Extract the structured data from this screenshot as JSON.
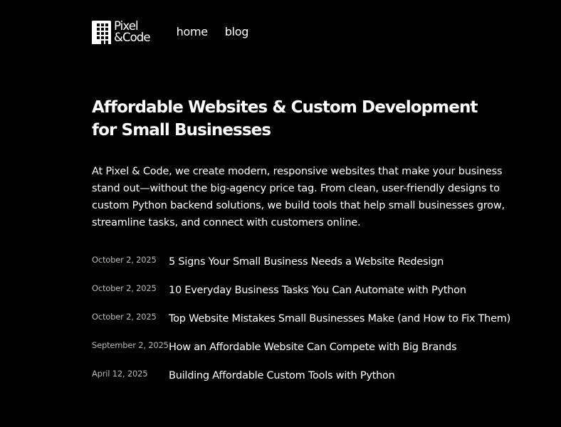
{
  "header": {
    "logo": {
      "line1": "Pixel",
      "line2": "&Code",
      "icon": "building-grid-icon"
    },
    "nav": [
      {
        "label": "home"
      },
      {
        "label": "blog"
      }
    ]
  },
  "hero": {
    "headline": "Affordable Websites & Custom Development for Small Businesses",
    "intro": "At Pixel & Code, we create modern, responsive websites that make your business stand out—without the big-agency price tag. From clean, user-friendly designs to custom Python backend solutions, we build tools that help small businesses grow, streamline tasks, and connect with customers online."
  },
  "posts": [
    {
      "date": "October 2, 2025",
      "title": "5 Signs Your Small Business Needs a Website Redesign"
    },
    {
      "date": "October 2, 2025",
      "title": "10 Everyday Business Tasks You Can Automate with Python"
    },
    {
      "date": "October 2, 2025",
      "title": "Top Website Mistakes Small Businesses Make (and How to Fix Them)"
    },
    {
      "date": "September 2, 2025",
      "title": "How an Affordable Website Can Compete with Big Brands"
    },
    {
      "date": "April 12, 2025",
      "title": "Building Affordable Custom Tools with Python"
    }
  ],
  "colors": {
    "background": "#000000",
    "text": "#ffffff",
    "date_text": "#b8b8b8"
  }
}
